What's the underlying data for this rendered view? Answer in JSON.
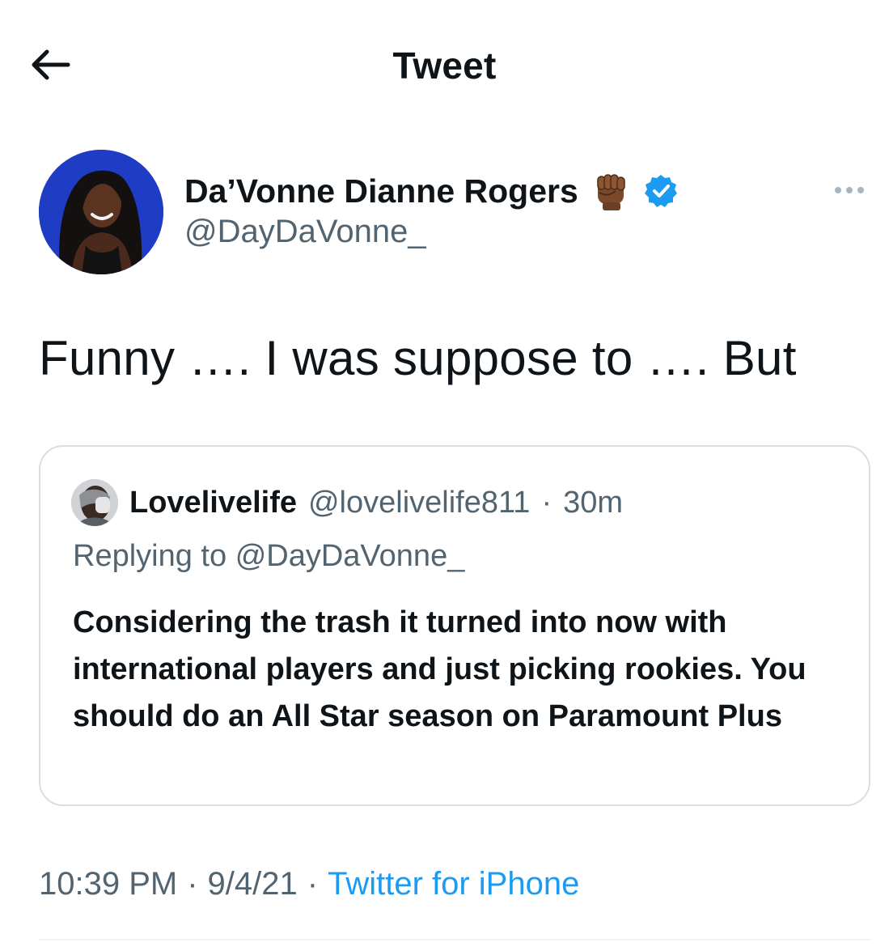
{
  "header": {
    "title": "Tweet"
  },
  "tweet": {
    "author": {
      "name": "Da’Vonne Dianne Rogers",
      "handle": "@DayDaVonne_",
      "verified": true,
      "emoji": "✊🏾"
    },
    "text": "Funny …. I was suppose to …. But",
    "time": "10:39 PM",
    "date": "9/4/21",
    "source": "Twitter for iPhone",
    "separator": "·"
  },
  "quoted": {
    "name": "Lovelivelife",
    "handle": "@lovelivelife811",
    "separator": "·",
    "age": "30m",
    "replying_label": "Replying to",
    "replying_to": "@DayDaVonne_",
    "text": "Considering the trash it turned into now with international players and just picking rookies.  You should do an All Star season on Paramount Plus"
  },
  "colors": {
    "text_primary": "#0f1419",
    "text_secondary": "#536471",
    "link_blue": "#1d9bf0",
    "border": "#d9dee2"
  }
}
